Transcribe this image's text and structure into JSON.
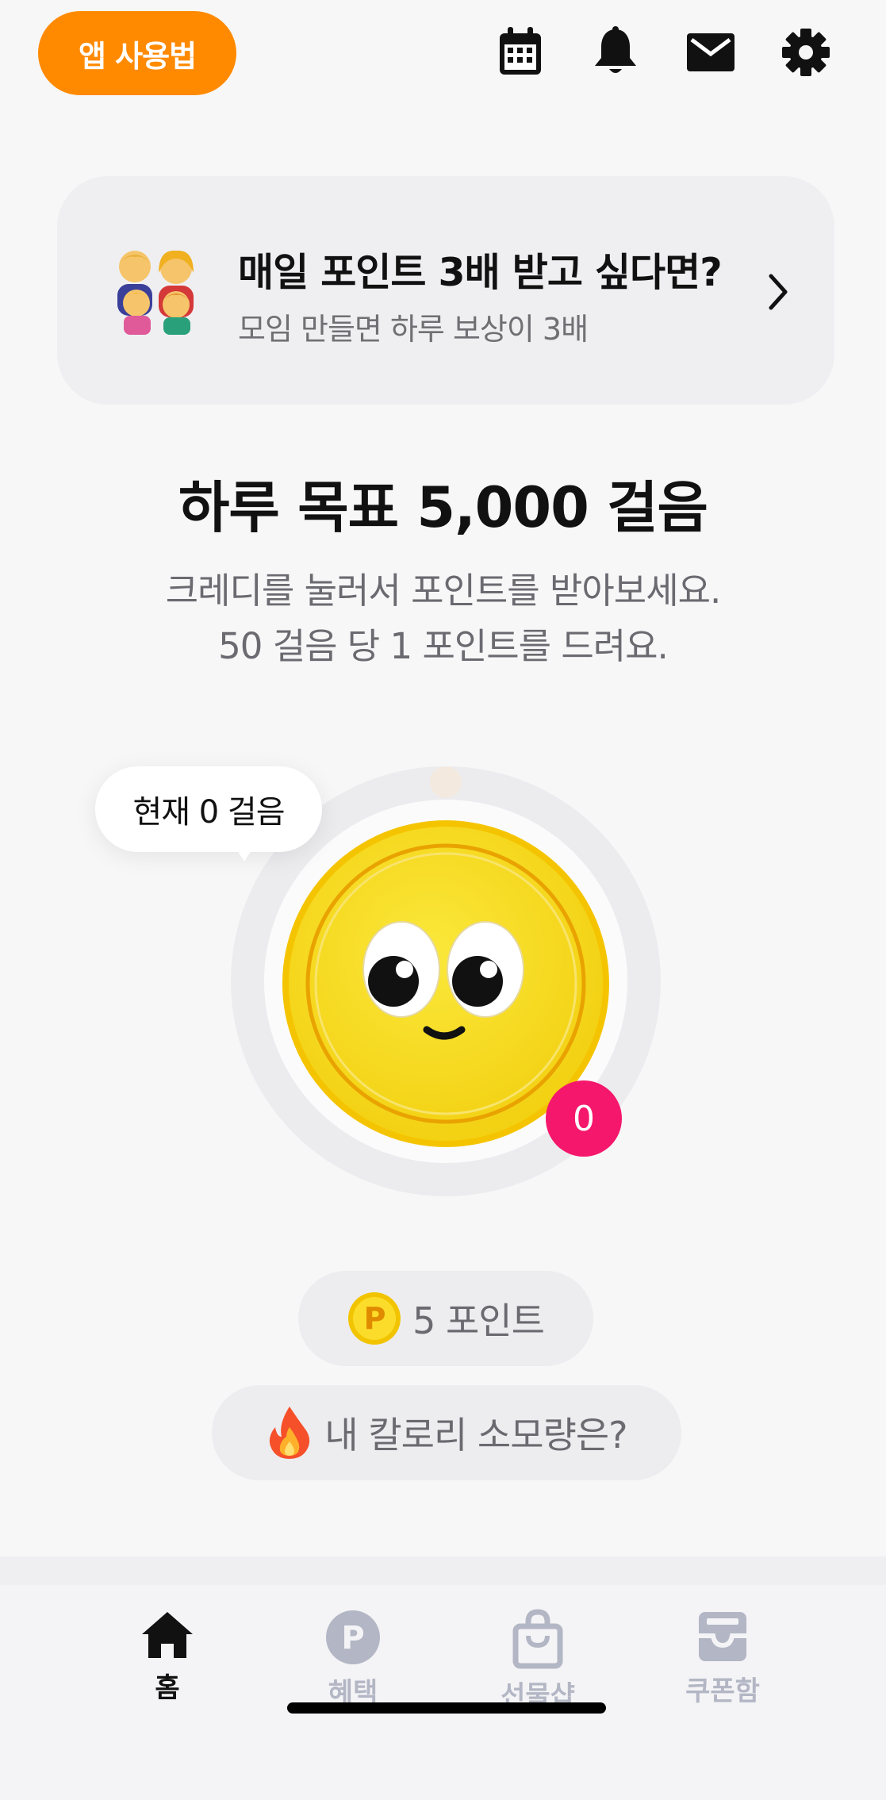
{
  "header": {
    "help_label": "앱 사용법",
    "icons": [
      "calendar-icon",
      "bell-icon",
      "mail-icon",
      "gear-icon"
    ]
  },
  "banner": {
    "title": "매일 포인트 3배 받고 싶다면?",
    "subtitle": "모임 만들면 하루 보상이 3배"
  },
  "goal": {
    "title": "하루 목표 5,000 걸음",
    "desc_line1": "크레디를 눌러서 포인트를 받아보세요.",
    "desc_line2": "50 걸음 당 1 포인트를 드려요."
  },
  "coin": {
    "current_steps_label": "현재 0 걸음",
    "badge_count": "0"
  },
  "points_pill": {
    "label": "5 포인트"
  },
  "calorie_pill": {
    "label": "내 칼로리 소모량은?"
  },
  "nav": {
    "items": [
      {
        "label": "홈",
        "active": true
      },
      {
        "label": "혜택",
        "active": false
      },
      {
        "label": "선물샵",
        "active": false
      },
      {
        "label": "쿠폰함",
        "active": false
      }
    ]
  },
  "colors": {
    "accent_orange": "#ff8a00",
    "badge_pink": "#f5176c",
    "coin_yellow": "#f7dc1c",
    "nav_inactive": "#b3b6c4"
  }
}
